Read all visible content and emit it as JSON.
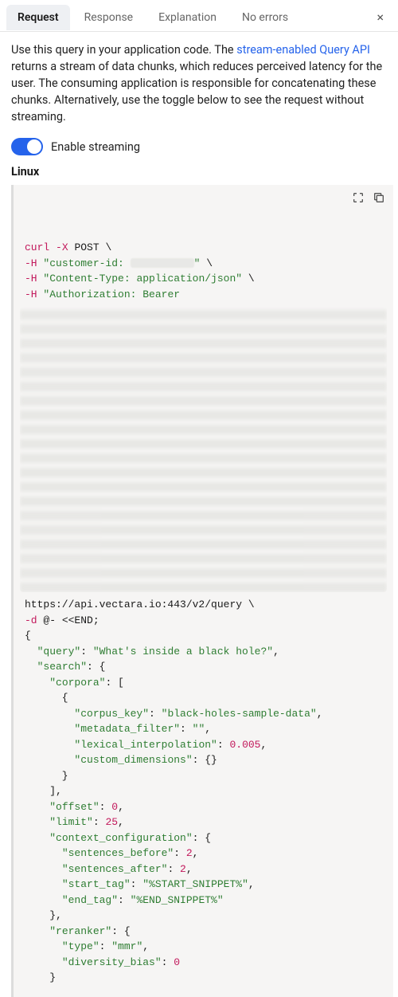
{
  "tabs": {
    "request": "Request",
    "response": "Response",
    "explanation": "Explanation",
    "noerrors": "No errors"
  },
  "description_pre": "Use this query in your application code. The ",
  "description_link": "stream-enabled Query API",
  "description_post": " returns a stream of data chunks, which reduces perceived latency for the user. The consuming application is responsible for concatenating these chunks. Alternatively, use the toggle below to see the request without streaming.",
  "toggle_label": "Enable streaming",
  "platform": "Linux",
  "code": {
    "curl": "curl",
    "xpost": "-X",
    "post": "POST",
    "h": "-H",
    "cust": "\"customer-id:",
    "custend": "\"",
    "ctype": "\"Content-Type: application/json\"",
    "auth": "\"Authorization: Bearer",
    "url": "https://api.vectara.io:443/v2/query",
    "d": "-d",
    "at": "@- <<END;",
    "json_lines": [
      "{",
      "  \"query\": \"What's inside a black hole?\",",
      "  \"search\": {",
      "    \"corpora\": [",
      "      {",
      "        \"corpus_key\": \"black-holes-sample-data\",",
      "        \"metadata_filter\": \"\",",
      "        \"lexical_interpolation\": 0.005,",
      "        \"custom_dimensions\": {}",
      "      }",
      "    ],",
      "    \"offset\": 0,",
      "    \"limit\": 25,",
      "    \"context_configuration\": {",
      "      \"sentences_before\": 2,",
      "      \"sentences_after\": 2,",
      "      \"start_tag\": \"%START_SNIPPET%\",",
      "      \"end_tag\": \"%END_SNIPPET%\"",
      "    },",
      "    \"reranker\": {",
      "      \"type\": \"mmr\",",
      "      \"diversity_bias\": 0",
      "    }"
    ]
  }
}
